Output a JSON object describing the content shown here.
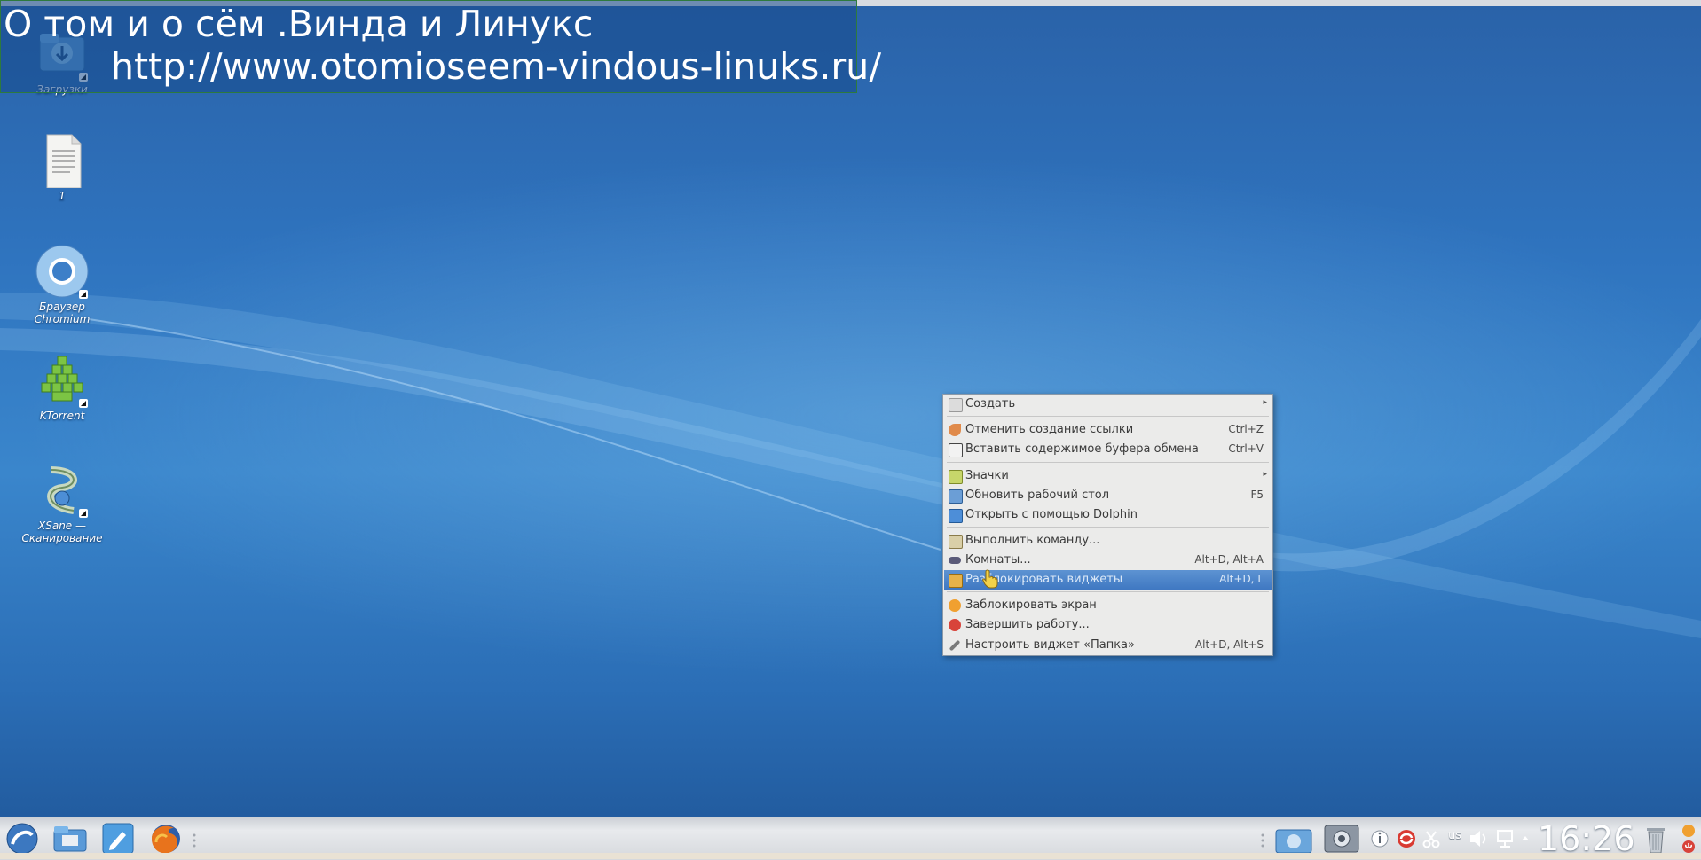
{
  "overlay": {
    "line1": "О том и о сём .Винда и Линукс",
    "line2": "http://www.otomioseem-vindous-linuks.ru/"
  },
  "desktop_icons": [
    {
      "label": "Загрузки",
      "icon": "folder-downloads-icon"
    },
    {
      "label": "1",
      "icon": "text-document-icon"
    },
    {
      "label": "Браузер Chromium",
      "icon": "chromium-icon"
    },
    {
      "label": "KTorrent",
      "icon": "ktorrent-icon"
    },
    {
      "label": "XSane — Сканирование",
      "icon": "xsane-icon"
    }
  ],
  "context_menu": {
    "items": [
      {
        "label": "Создать",
        "shortcut": "",
        "submenu": true,
        "icon": "new-icon"
      },
      {
        "label": "Отменить создание ссылки",
        "shortcut": "Ctrl+Z",
        "icon": "undo-icon"
      },
      {
        "label": "Вставить содержимое буфера обмена",
        "shortcut": "Ctrl+V",
        "icon": "paste-icon"
      },
      {
        "label": "Значки",
        "shortcut": "",
        "submenu": true,
        "icon": "icons-view-icon"
      },
      {
        "label": "Обновить рабочий стол",
        "shortcut": "F5",
        "icon": "refresh-icon"
      },
      {
        "label": "Открыть с помощью Dolphin",
        "shortcut": "",
        "icon": "dolphin-icon"
      },
      {
        "label": "Выполнить команду...",
        "shortcut": "",
        "icon": "run-command-icon"
      },
      {
        "label": "Комнаты...",
        "shortcut": "Alt+D, Alt+A",
        "icon": "activities-icon"
      },
      {
        "label": "Разблокировать виджеты",
        "shortcut": "Alt+D, L",
        "icon": "unlock-icon",
        "highlighted": true
      },
      {
        "label": "Заблокировать экран",
        "shortcut": "",
        "icon": "lock-screen-icon"
      },
      {
        "label": "Завершить работу...",
        "shortcut": "",
        "icon": "shutdown-icon"
      },
      {
        "label": "Настроить виджет «Папка»",
        "shortcut": "Alt+D, Alt+S",
        "icon": "configure-icon"
      }
    ]
  },
  "taskbar": {
    "launchers": [
      "kde-menu-icon",
      "file-manager-icon",
      "text-editor-icon",
      "firefox-icon"
    ],
    "tray": {
      "keyboard_layout": "us",
      "clock": "16:26"
    }
  },
  "colors": {
    "desktop": "#2f74bf",
    "menu_bg": "#ebebea",
    "menu_highlight": "#4a82c8",
    "panel": "#dfe1e4"
  }
}
